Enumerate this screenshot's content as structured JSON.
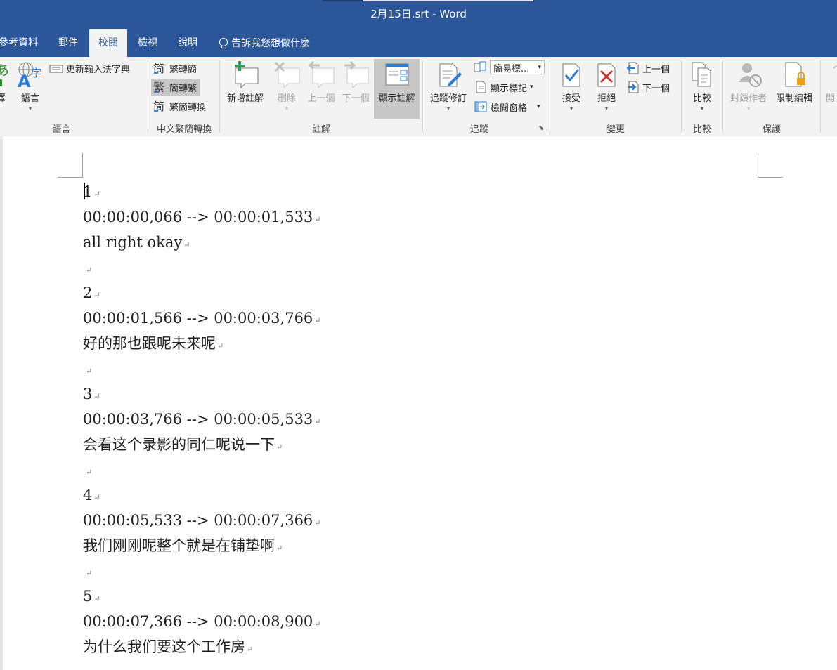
{
  "window": {
    "title": "2月15日.srt  -  Word"
  },
  "tabs": [
    {
      "label": "參考資料",
      "active": false
    },
    {
      "label": "郵件",
      "active": false
    },
    {
      "label": "校閱",
      "active": true
    },
    {
      "label": "檢視",
      "active": false
    },
    {
      "label": "說明",
      "active": false
    }
  ],
  "tell_me": "告訴我您想做什麼",
  "ribbon": {
    "groups": {
      "language": "語言",
      "chinese_conversion": "中文繁簡轉換",
      "comments": "註解",
      "tracking": "追蹤",
      "changes": "變更",
      "compare": "比較",
      "protect": "保護"
    },
    "language": {
      "translate_label": "譯",
      "language_label": "語言",
      "update_ime_dict": "更新輸入法字典"
    },
    "conversion": {
      "to_simplified": "繁轉簡",
      "to_traditional": "簡轉繁",
      "convert": "繁簡轉換"
    },
    "comments": {
      "new": "新增註解",
      "delete": "刪除",
      "previous": "上一個",
      "next": "下一個",
      "show": "顯示註解"
    },
    "tracking": {
      "track_changes": "追蹤修訂",
      "markup_select": "簡易標...",
      "show_markup": "顯示標記",
      "review_pane": "檢閱窗格"
    },
    "changes": {
      "accept": "接受",
      "reject": "拒絕",
      "previous": "上一個",
      "next": "下一個"
    },
    "compare": {
      "compare": "比較"
    },
    "protect": {
      "block_authors": "封鎖作者",
      "restrict_editing": "限制編輯",
      "partial_next": "開"
    }
  },
  "document": {
    "lines": [
      "1",
      "00:00:00,066 --> 00:00:01,533",
      "all right okay",
      "",
      "2",
      "00:00:01,566 --> 00:00:03,766",
      "好的那也跟呢未来呢",
      "",
      "3",
      "00:00:03,766 --> 00:00:05,533",
      "会看这个录影的同仁呢说一下",
      "",
      "4",
      "00:00:05,533 --> 00:00:07,366",
      "我们刚刚呢整个就是在铺垫啊",
      "",
      "5",
      "00:00:07,366 --> 00:00:08,900",
      "为什么我们要这个工作房"
    ],
    "paragraph_mark": "↵"
  }
}
